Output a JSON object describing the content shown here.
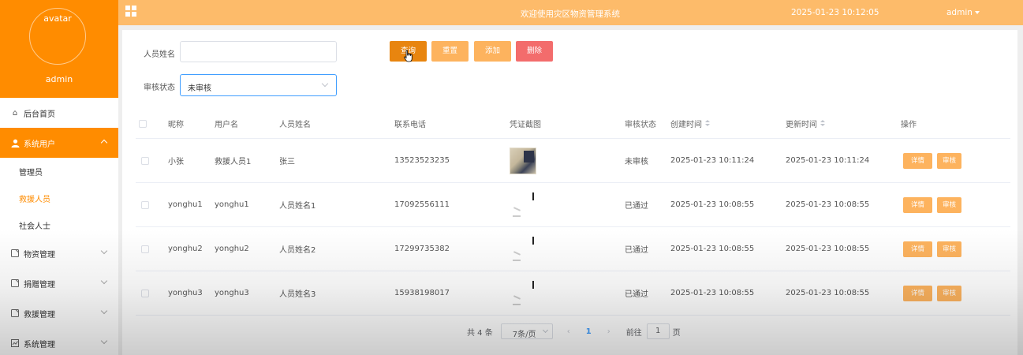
{
  "colors": {
    "accent": "#ff8c00",
    "topbar": "#fdbb6a",
    "danger": "#f36c6c",
    "link": "#409eff"
  },
  "sidebar": {
    "avatar_text": "avatar",
    "username": "admin",
    "home": "后台首页",
    "system_users": "系统用户",
    "sub_items": [
      "管理员",
      "救援人员",
      "社会人士"
    ],
    "current_sub": "救援人员",
    "menus": [
      "物资管理",
      "捐赠管理",
      "救援管理",
      "系统管理"
    ]
  },
  "topbar": {
    "title": "欢迎使用灾区物资管理系统",
    "datetime": "2025-01-23 10:12:05",
    "user": "admin"
  },
  "search": {
    "name_label": "人员姓名",
    "name_value": "",
    "status_label": "审核状态",
    "status_value": "未审核",
    "buttons": {
      "query": "查询",
      "reset": "重置",
      "add": "添加",
      "delete": "删除"
    }
  },
  "table": {
    "headers": [
      "昵称",
      "用户名",
      "人员姓名",
      "联系电话",
      "凭证截图",
      "审核状态",
      "创建时间",
      "更新时间",
      "操作"
    ],
    "rows": [
      {
        "nickname": "小张",
        "username": "救援人员1",
        "name": "张三",
        "phone": "13523523235",
        "proof": "image",
        "status": "未审核",
        "created": "2025-01-23 10:11:24",
        "updated": "2025-01-23 10:11:24"
      },
      {
        "nickname": "yonghu1",
        "username": "yonghu1",
        "name": "人员姓名1",
        "phone": "17092556111",
        "proof": "loading",
        "status": "已通过",
        "created": "2025-01-23 10:08:55",
        "updated": "2025-01-23 10:08:55"
      },
      {
        "nickname": "yonghu2",
        "username": "yonghu2",
        "name": "人员姓名2",
        "phone": "17299735382",
        "proof": "loading",
        "status": "已通过",
        "created": "2025-01-23 10:08:55",
        "updated": "2025-01-23 10:08:55"
      },
      {
        "nickname": "yonghu3",
        "username": "yonghu3",
        "name": "人员姓名3",
        "phone": "15938198017",
        "proof": "loading",
        "status": "已通过",
        "created": "2025-01-23 10:08:55",
        "updated": "2025-01-23 10:08:55"
      }
    ],
    "actions": {
      "detail": "详情",
      "audit": "审核"
    }
  },
  "pagination": {
    "total": "共 4 条",
    "page_size": "7条/页",
    "current": "1",
    "goto_label": "前往",
    "goto_value": "1",
    "page_suffix": "页"
  }
}
